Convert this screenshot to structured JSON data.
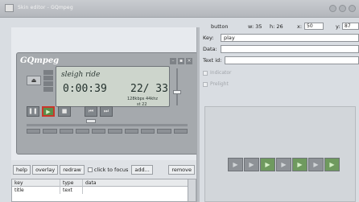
{
  "window": {
    "title": "Skin editor - GQmpeg",
    "app_icon": "skin-editor-icon"
  },
  "skin": {
    "title": "GQmpeg",
    "window_buttons": [
      "–",
      "▪",
      "×"
    ],
    "eject_glyph": "⏏",
    "lcd": {
      "song": "sleigh ride",
      "time": "0:00:39",
      "track": "22/ 33",
      "rate": "128kbps 44khz",
      "mode": "st  22"
    },
    "volume_level": 0.35,
    "controls": {
      "pause": "❚❚",
      "play": "▶",
      "stop": "■",
      "prev": "⏮",
      "next": "⏭"
    }
  },
  "button_bar": {
    "help": "help",
    "overlay": "overlay",
    "redraw": "redraw",
    "click_to_focus": "click to focus",
    "add": "add...",
    "remove": "remove"
  },
  "table": {
    "columns": [
      "key",
      "type",
      "data"
    ],
    "rows": [
      {
        "key": "title",
        "type": "text",
        "data": ""
      }
    ]
  },
  "properties": {
    "widget_type": "button",
    "w_label": "w: 35",
    "h_label": "h: 26",
    "x_label": "x:",
    "x_value": "50",
    "y_label": "y:",
    "y_value": "87",
    "key_label": "Key:",
    "key_value": "play",
    "data_label": "Data:",
    "data_value": "",
    "textid_label": "Text id:",
    "textid_value": "",
    "indicator_label": "Indicator",
    "prelight_label": "Prelight"
  },
  "preview_tiles": [
    "▶",
    "▶",
    "▶",
    "▶",
    "▶",
    "▶",
    "▶"
  ]
}
